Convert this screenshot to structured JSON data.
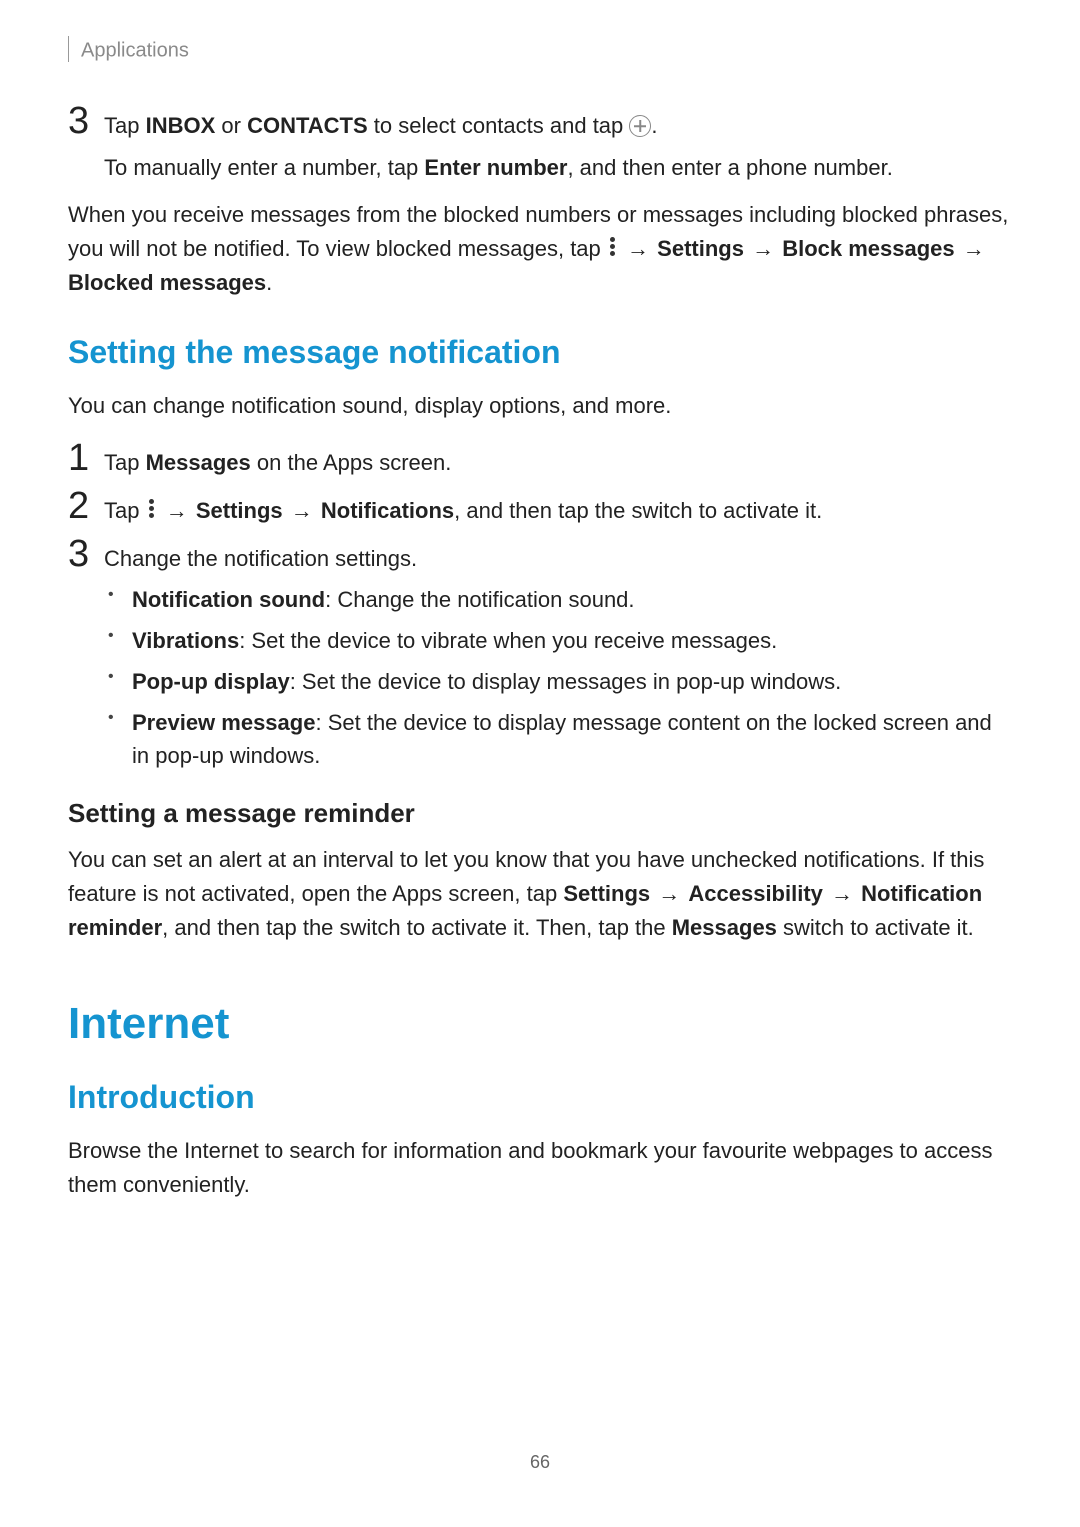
{
  "header": "Applications",
  "pageNumber": "66",
  "arrow": "→",
  "step3": {
    "num": "3",
    "line_pre": "Tap ",
    "bold1": "INBOX",
    "mid1": " or ",
    "bold2": "CONTACTS",
    "tail": " to select contacts and tap ",
    "period": ".",
    "sub_pre": "To manually enter a number, tap ",
    "sub_bold": "Enter number",
    "sub_tail": ", and then enter a phone number."
  },
  "block_para": {
    "p1": "When you receive messages from the blocked numbers or messages including blocked phrases, you will not be notified. To view blocked messages, tap ",
    "b_settings": "Settings",
    "b_block": "Block messages",
    "b_blocked": "Blocked messages",
    "period": "."
  },
  "h2_notif": "Setting the message notification",
  "notif_intro": "You can change notification sound, display options, and more.",
  "nstep1": {
    "num": "1",
    "pre": "Tap ",
    "bold": "Messages",
    "tail": " on the Apps screen."
  },
  "nstep2": {
    "num": "2",
    "pre": "Tap ",
    "b_settings": "Settings",
    "b_notifs": "Notifications",
    "tail": ", and then tap the switch to activate it."
  },
  "nstep3": {
    "num": "3",
    "text": "Change the notification settings."
  },
  "bullets": {
    "b1_bold": "Notification sound",
    "b1_text": ": Change the notification sound.",
    "b2_bold": "Vibrations",
    "b2_text": ": Set the device to vibrate when you receive messages.",
    "b3_bold": "Pop-up display",
    "b3_text": ": Set the device to display messages in pop-up windows.",
    "b4_bold": "Preview message",
    "b4_text": ": Set the device to display message content on the locked screen and in pop-up windows."
  },
  "h3_reminder": "Setting a message reminder",
  "reminder": {
    "p1": "You can set an alert at an interval to let you know that you have unchecked notifications. If this feature is not activated, open the Apps screen, tap ",
    "b_settings": "Settings",
    "b_access": "Accessibility",
    "b_notifrem": "Notification reminder",
    "p2": ", and then tap the switch to activate it. Then, tap the ",
    "b_msgs": "Messages",
    "p3": " switch to activate it."
  },
  "h1_internet": "Internet",
  "h2_intro": "Introduction",
  "intro_text": "Browse the Internet to search for information and bookmark your favourite webpages to access them conveniently."
}
